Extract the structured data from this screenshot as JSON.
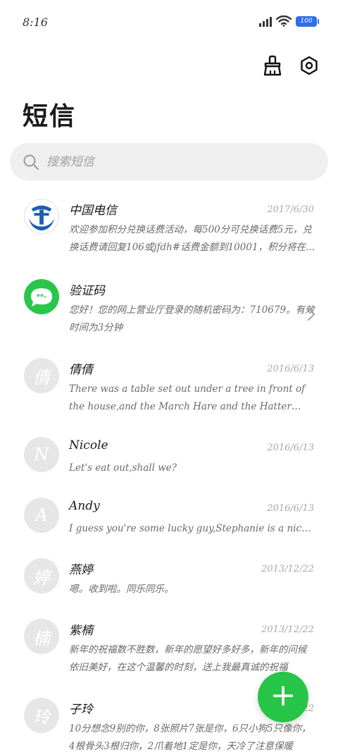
{
  "status_bar": {
    "time": "8:16",
    "battery": "100"
  },
  "header": {
    "title": "短信"
  },
  "search": {
    "placeholder": "搜索短信"
  },
  "conversations": [
    {
      "avatar": "",
      "avatar_type": "telecom",
      "name": "中国电信",
      "date": "2017/6/30",
      "preview": "欢迎参加积分兑换话费活动，每500分可兑换话费5元，兑换话费请回复106或jfdh#话费金额到10001，积分将在..."
    },
    {
      "avatar": "",
      "avatar_type": "sms",
      "name": "验证码",
      "date": "",
      "preview": "您好！您的网上营业厅登录的随机密码为：710679。有效时间为3分钟"
    },
    {
      "avatar": "倩",
      "avatar_type": "letter",
      "name": "倩倩",
      "date": "2016/6/13",
      "preview": "There was a table set out under a tree in front of the house,and the March Hare and the Hatter were having tea at it"
    },
    {
      "avatar": "N",
      "avatar_type": "letter",
      "name": "Nicole",
      "date": "2016/6/13",
      "preview": "Let's eat out,shall we?"
    },
    {
      "avatar": "A",
      "avatar_type": "letter",
      "name": "Andy",
      "date": "2016/6/13",
      "preview": "I guess you're some lucky guy,Stephanie is a nice girl."
    },
    {
      "avatar": "婷",
      "avatar_type": "letter",
      "name": "燕婷",
      "date": "2013/12/22",
      "preview": "嗯。收到啦。同乐同乐。"
    },
    {
      "avatar": "楠",
      "avatar_type": "letter",
      "name": "紫楠",
      "date": "2013/12/22",
      "preview": "新年的祝福数不胜数，新年的愿望好多好多，新年的问候依旧美好，在这个温馨的时刻，送上我最真诚的祝福"
    },
    {
      "avatar": "玲",
      "avatar_type": "letter",
      "name": "子玲",
      "date": "2013/12/22",
      "preview": "10分想念9别的你，8张照片7张是你，6只小狗5只像你，4根骨头3根归你，2爪着地1定是你，天冷了注意保暖"
    }
  ],
  "colors": {
    "accent_green": "#26c548",
    "battery_blue": "#2f6cf0",
    "telecom_blue": "#1a5fb4"
  },
  "icons": {
    "clean": "broom-icon",
    "settings": "settings-hexagon-icon",
    "search": "search-icon",
    "fab": "plus-icon",
    "chevron": "chevron-right-icon"
  }
}
